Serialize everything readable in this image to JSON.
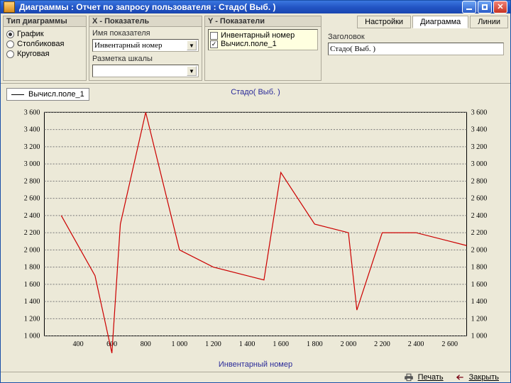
{
  "window": {
    "title": "Диаграммы : Отчет по запросу пользователя : Стадо( Выб.  )"
  },
  "panel_type": {
    "title": "Тип диаграммы",
    "options": [
      "График",
      "Столбиковая",
      "Круговая"
    ],
    "selected": "График"
  },
  "panel_x": {
    "title": "X - Показатель",
    "field_label": "Имя показателя",
    "field_value": "Инвентарный номер",
    "scale_label": "Разметка шкалы",
    "scale_value": ""
  },
  "panel_y": {
    "title": "Y - Показатели",
    "items": [
      {
        "label": "Инвентарный номер",
        "checked": false
      },
      {
        "label": "Вычисл.поле_1",
        "checked": true
      }
    ]
  },
  "panel_right": {
    "tabs": [
      "Настройки",
      "Диаграмма",
      "Линии"
    ],
    "active_tab": "Диаграмма",
    "title_label": "Заголовок",
    "title_value": "Стадо( Выб.  )"
  },
  "legend": {
    "label": "Вычисл.поле_1"
  },
  "footer": {
    "print": "Печать",
    "close": "Закрыть"
  },
  "chart_data": {
    "type": "line",
    "title": "Стадо( Выб.  )",
    "xlabel": "Инвентарный номер",
    "ylabel": "",
    "xlim": [
      200,
      2700
    ],
    "ylim": [
      1000,
      3600
    ],
    "y_ticks": [
      1000,
      1200,
      1400,
      1600,
      1800,
      2000,
      2200,
      2400,
      2600,
      2800,
      3000,
      3200,
      3400,
      3600
    ],
    "x_ticks": [
      400,
      600,
      800,
      1000,
      1200,
      1400,
      1600,
      1800,
      2000,
      2200,
      2400,
      2600
    ],
    "series": [
      {
        "name": "Вычисл.поле_1",
        "color": "#c00",
        "x": [
          300,
          500,
          600,
          650,
          800,
          1000,
          1200,
          1400,
          1500,
          1600,
          1800,
          2000,
          2050,
          2200,
          2400,
          2600,
          2700
        ],
        "y": [
          2400,
          1700,
          800,
          2300,
          3600,
          2000,
          1800,
          1700,
          1650,
          2900,
          2300,
          2200,
          1300,
          2200,
          2200,
          2100,
          2050
        ]
      }
    ]
  }
}
